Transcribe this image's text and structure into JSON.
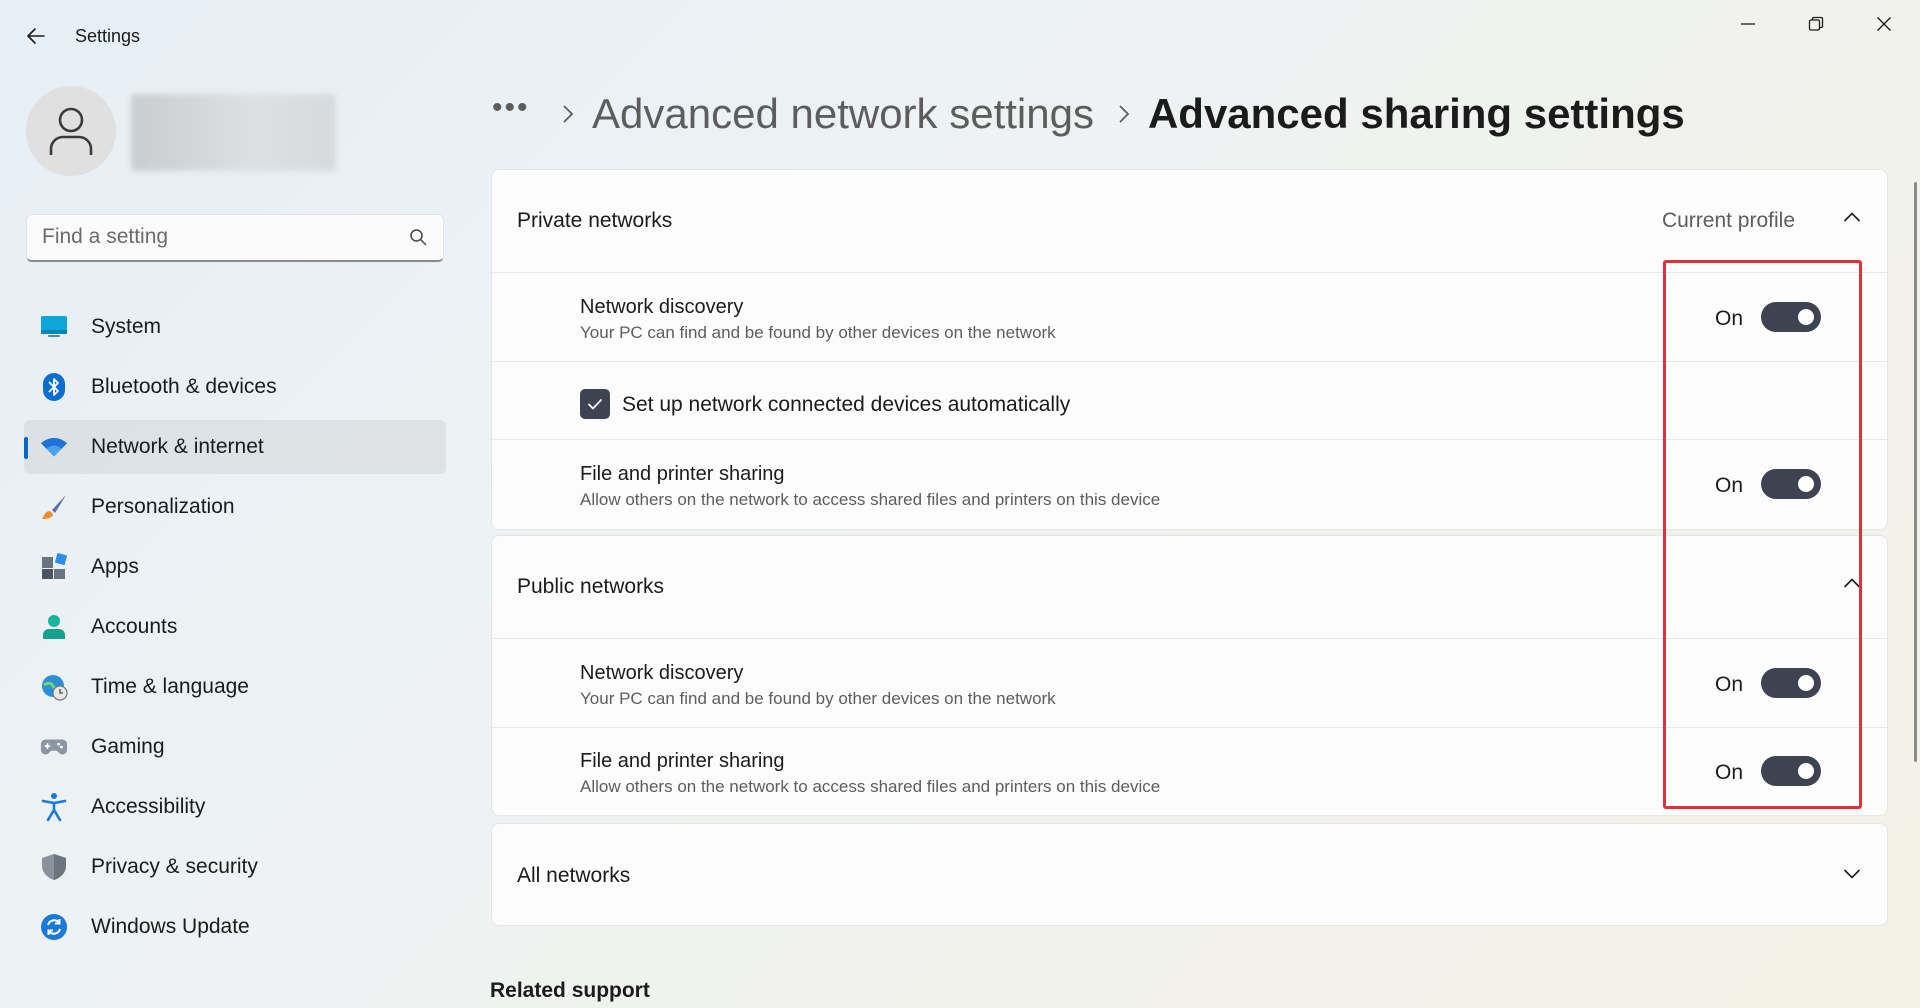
{
  "window": {
    "title": "Settings"
  },
  "search": {
    "placeholder": "Find a setting"
  },
  "sidebar": {
    "items": [
      {
        "label": "System",
        "icon": "system-icon"
      },
      {
        "label": "Bluetooth & devices",
        "icon": "bluetooth-icon"
      },
      {
        "label": "Network & internet",
        "icon": "wifi-icon",
        "active": true
      },
      {
        "label": "Personalization",
        "icon": "brush-icon"
      },
      {
        "label": "Apps",
        "icon": "apps-icon"
      },
      {
        "label": "Accounts",
        "icon": "accounts-icon"
      },
      {
        "label": "Time & language",
        "icon": "globe-clock-icon"
      },
      {
        "label": "Gaming",
        "icon": "gamepad-icon"
      },
      {
        "label": "Accessibility",
        "icon": "accessibility-icon"
      },
      {
        "label": "Privacy & security",
        "icon": "shield-icon"
      },
      {
        "label": "Windows Update",
        "icon": "update-icon"
      }
    ]
  },
  "breadcrumb": {
    "more": "•••",
    "parent": "Advanced network settings",
    "current": "Advanced sharing settings"
  },
  "private_networks": {
    "title": "Private networks",
    "badge": "Current profile",
    "network_discovery": {
      "title": "Network discovery",
      "description": "Your PC can find and be found by other devices on the network",
      "state": "On"
    },
    "auto_setup": {
      "label": "Set up network connected devices automatically",
      "checked": true
    },
    "file_sharing": {
      "title": "File and printer sharing",
      "description": "Allow others on the network to access shared files and printers on this device",
      "state": "On"
    }
  },
  "public_networks": {
    "title": "Public networks",
    "network_discovery": {
      "title": "Network discovery",
      "description": "Your PC can find and be found by other devices on the network",
      "state": "On"
    },
    "file_sharing": {
      "title": "File and printer sharing",
      "description": "Allow others on the network to access shared files and printers on this device",
      "state": "On"
    }
  },
  "all_networks": {
    "title": "All networks"
  },
  "related_support": {
    "title": "Related support"
  },
  "colors": {
    "accent": "#0067c0",
    "toggle_on": "#3d4351",
    "highlight": "#e0313a"
  }
}
